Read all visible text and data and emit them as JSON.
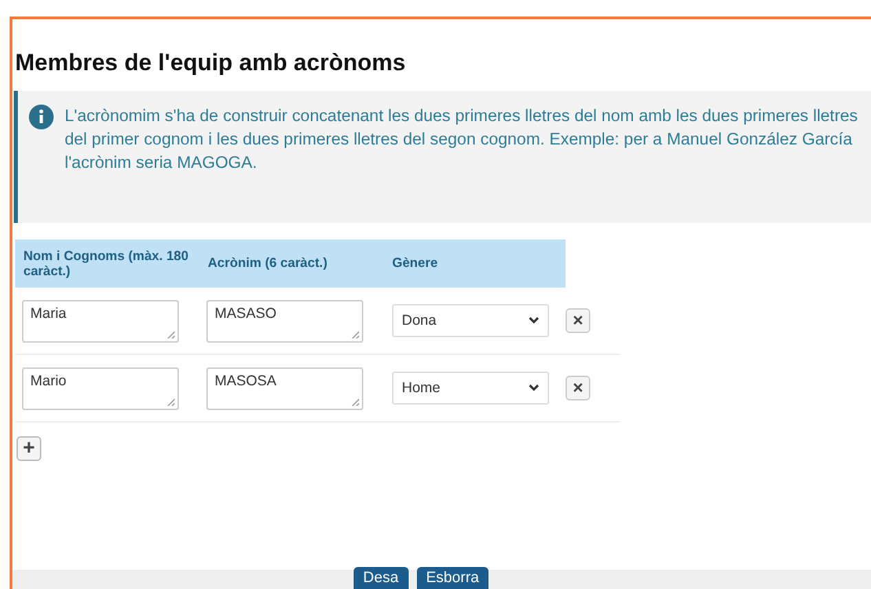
{
  "title": "Membres de l'equip amb acrònoms",
  "info": "L'acrònomim s'ha de construir concatenant les dues primeres lletres del nom amb les dues primeres lletres del primer cognom i les dues primeres lletres del segon cognom. Exemple: per a Manuel González García l'acrònim seria MAGOGA.",
  "table": {
    "columns": [
      "Nom i Cognoms (màx. 180 caràct.)",
      "Acrònim (6 caràct.)",
      "Gènere"
    ],
    "rows": [
      {
        "name": "Maria",
        "acronym": "MASASO",
        "gender": "Dona",
        "remove": "×"
      },
      {
        "name": "Mario",
        "acronym": "MASOSA",
        "gender": "Home",
        "remove": "×"
      }
    ]
  },
  "add_button": "+",
  "buttons": [
    "Desa",
    "Esborra"
  ]
}
